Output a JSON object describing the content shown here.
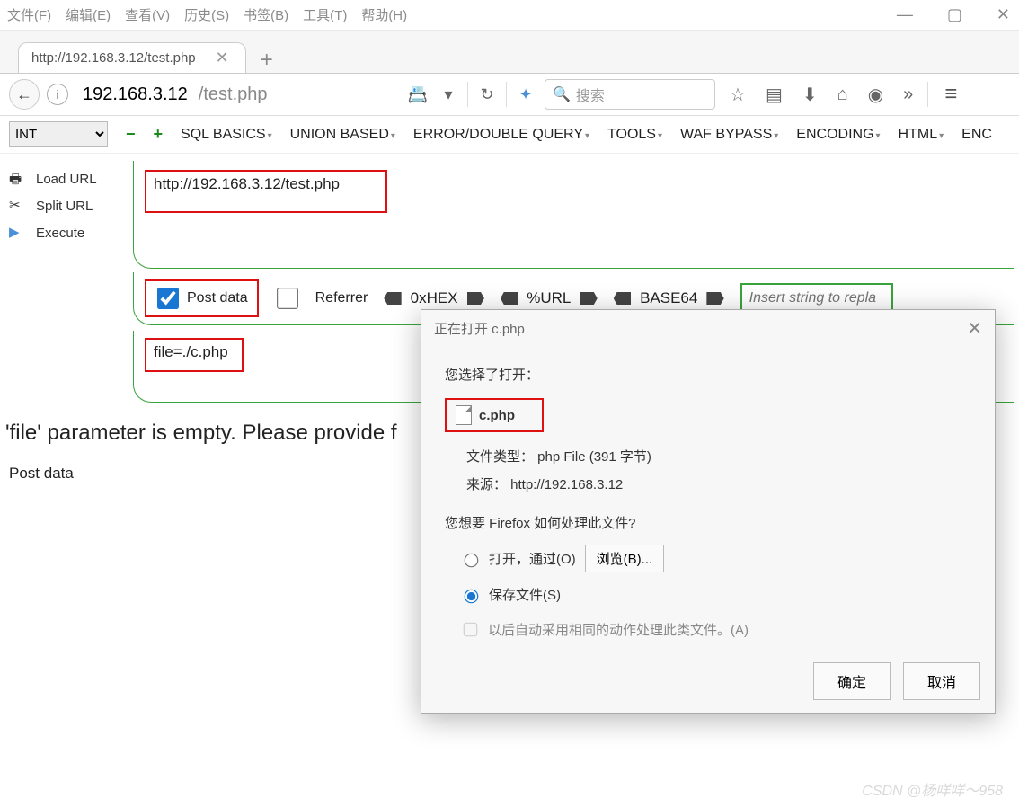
{
  "menu": {
    "file": "文件(F)",
    "edit": "编辑(E)",
    "view": "查看(V)",
    "history": "历史(S)",
    "bookmarks": "书签(B)",
    "tools": "工具(T)",
    "help": "帮助(H)"
  },
  "window": {
    "min": "—",
    "max": "▢",
    "close": "✕"
  },
  "tabs": {
    "active": "http://192.168.3.12/test.php",
    "close": "✕",
    "new": "+"
  },
  "nav": {
    "back": "←",
    "info": "i",
    "host": "192.168.3.12",
    "path": "/test.php",
    "search_placeholder": "搜索"
  },
  "toolbar_icons": {
    "star": "☆",
    "clip": "▤",
    "down": "⬇",
    "home": "⌂",
    "globe": "◉",
    "more": "»",
    "menu": "≡"
  },
  "hackbar": {
    "int": "INT",
    "minus": "−",
    "plus": "+",
    "sql": "SQL BASICS",
    "union": "UNION BASED",
    "error": "ERROR/DOUBLE QUERY",
    "tools": "TOOLS",
    "waf": "WAF BYPASS",
    "encoding": "ENCODING",
    "html": "HTML",
    "enc": "ENC",
    "load": "Load URL",
    "split": "Split URL",
    "exec": "Execute",
    "url": "http://192.168.3.12/test.php",
    "post_chk": "Post data",
    "ref_chk": "Referrer",
    "hex": "0xHEX",
    "urlenc": "%URL",
    "b64": "BASE64",
    "replace_ph": "Insert string to repla",
    "post_label": "Post data",
    "post_val": "file=./c.php"
  },
  "page": {
    "msg": "'file' parameter is empty. Please provide f"
  },
  "dialog": {
    "title": "正在打开 c.php",
    "chosen": "您选择了打开：",
    "filename": "c.php",
    "filetype": "文件类型：   php File (391 字节)",
    "source": "来源：   http://192.168.3.12",
    "how": "您想要 Firefox 如何处理此文件?",
    "open": "打开，通过(O)",
    "browse": "浏览(B)...",
    "save": "保存文件(S)",
    "auto": "以后自动采用相同的动作处理此类文件。(A)",
    "ok": "确定",
    "cancel": "取消"
  },
  "watermark": "CSDN @杨咩咩～958"
}
